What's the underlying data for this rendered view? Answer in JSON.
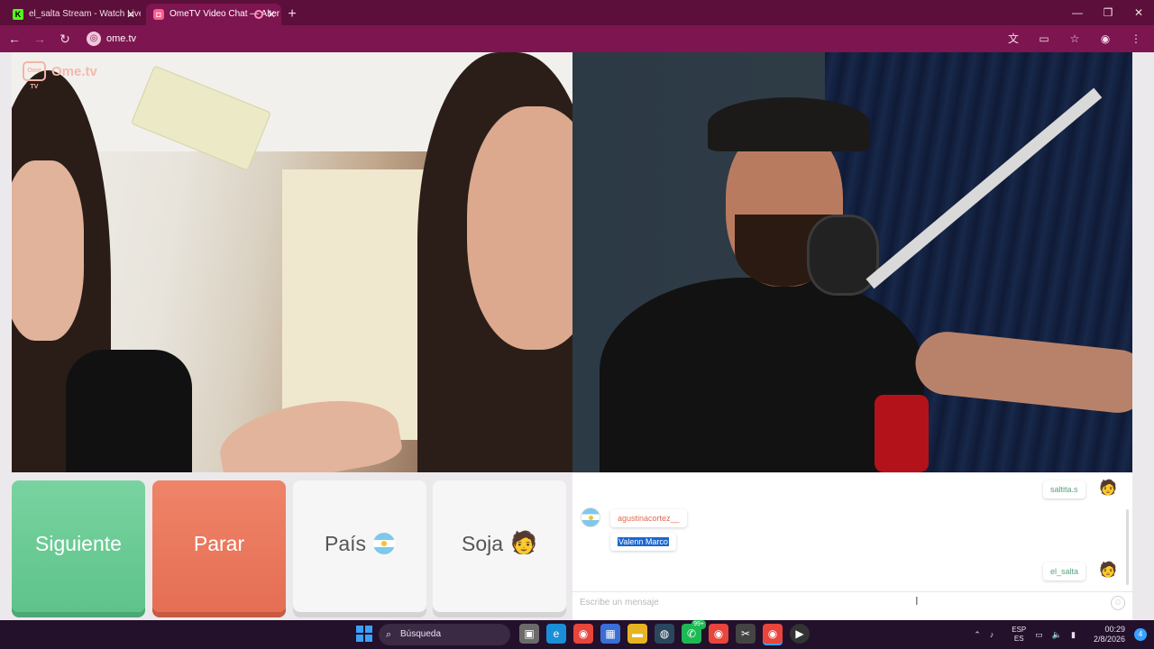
{
  "browser": {
    "tabs": [
      {
        "label": "el_salta Stream - Watch Live on",
        "favicon": "kick-icon",
        "active": false
      },
      {
        "label": "OmeTV Video Chat — Alter",
        "favicon": "ometv-icon",
        "active": true
      }
    ],
    "url": "ome.tv"
  },
  "app": {
    "brand": "Ome.tv",
    "logo_text": "Ome TV"
  },
  "controls": {
    "next": "Siguiente",
    "stop": "Parar",
    "country": "País",
    "gender": "Soja"
  },
  "chat": {
    "messages": [
      {
        "author": "saltita.s",
        "side": "me"
      },
      {
        "author": "agustinacortez__",
        "side": "them"
      },
      {
        "text": "Valenn Marco",
        "side": "them",
        "selected": true
      },
      {
        "author": "el_salta",
        "side": "me"
      }
    ],
    "placeholder": "Escribe un mensaje"
  },
  "taskbar": {
    "search": "Búsqueda",
    "badge": "99+",
    "lang_top": "ESP",
    "lang_bottom": "ES",
    "time": "00:29",
    "date": "2/8/2026",
    "notifications": "4"
  },
  "colors": {
    "tabbar": "#5c0f3a",
    "toolbar": "#7d1550",
    "next": "#5ec38a",
    "stop": "#e56e53",
    "me_name": "#54a37a",
    "them_name": "#e06a52"
  }
}
